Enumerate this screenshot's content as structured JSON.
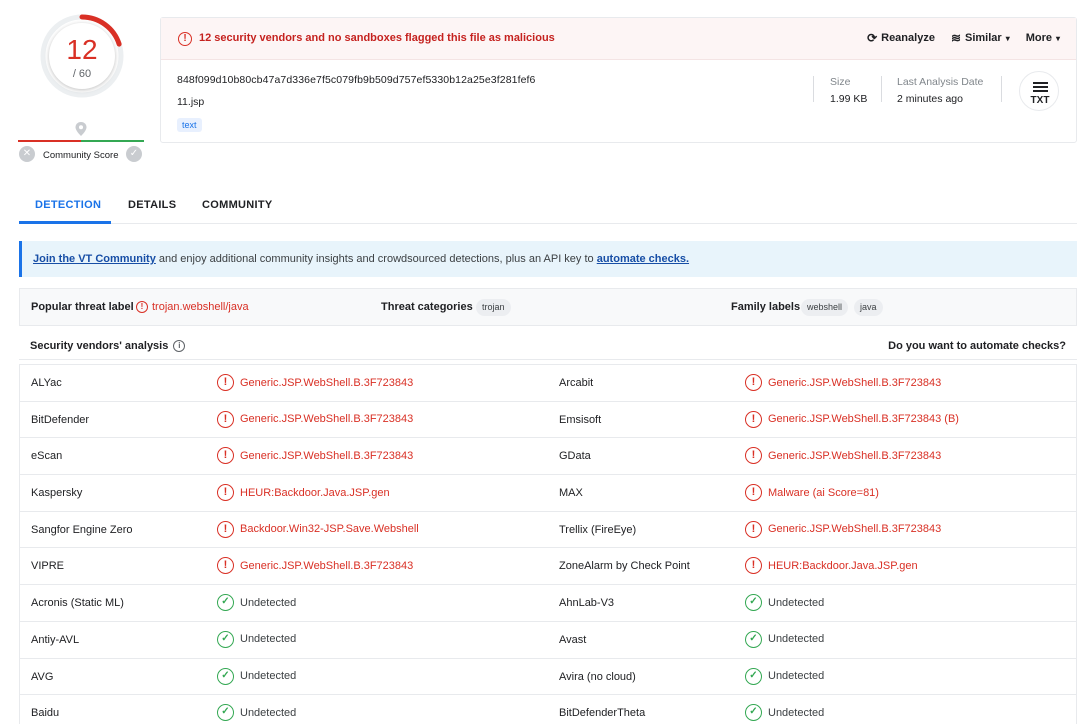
{
  "score": {
    "detections": "12",
    "total": "/ 60",
    "community_label": "Community Score",
    "fraction_flagged": 0.2
  },
  "alert": {
    "text": "12 security vendors and no sandboxes flagged this file as malicious"
  },
  "actions": {
    "reanalyze": "Reanalyze",
    "similar": "Similar",
    "more": "More"
  },
  "file": {
    "hash": "848f099d10b80cb47a7d336e7f5c079fb9b509d757ef5330b12a25e3f281fef6",
    "name": "11.jsp",
    "tag": "text",
    "size_label": "Size",
    "size_value": "1.99 KB",
    "date_label": "Last Analysis Date",
    "date_value": "2 minutes ago",
    "type_badge": "TXT"
  },
  "tabs": [
    {
      "label": "DETECTION"
    },
    {
      "label": "DETAILS"
    },
    {
      "label": "COMMUNITY"
    }
  ],
  "banner": {
    "link1": "Join the VT Community",
    "middle": " and enjoy additional community insights and crowdsourced detections, plus an API key to ",
    "link2": "automate checks."
  },
  "threat": {
    "popular_label": "Popular threat label",
    "popular_value": "trojan.webshell/java",
    "categories_label": "Threat categories",
    "categories": [
      "trojan"
    ],
    "family_label": "Family labels",
    "family": [
      "webshell",
      "java"
    ]
  },
  "analysis": {
    "title": "Security vendors' analysis",
    "automate": "Do you want to automate checks?"
  },
  "vendors": [
    {
      "left": {
        "name": "ALYac",
        "result": "Generic.JSP.WebShell.B.3F723843",
        "malicious": true
      },
      "right": {
        "name": "Arcabit",
        "result": "Generic.JSP.WebShell.B.3F723843",
        "malicious": true
      }
    },
    {
      "left": {
        "name": "BitDefender",
        "result": "Generic.JSP.WebShell.B.3F723843",
        "malicious": true
      },
      "right": {
        "name": "Emsisoft",
        "result": "Generic.JSP.WebShell.B.3F723843 (B)",
        "malicious": true
      }
    },
    {
      "left": {
        "name": "eScan",
        "result": "Generic.JSP.WebShell.B.3F723843",
        "malicious": true
      },
      "right": {
        "name": "GData",
        "result": "Generic.JSP.WebShell.B.3F723843",
        "malicious": true
      }
    },
    {
      "left": {
        "name": "Kaspersky",
        "result": "HEUR:Backdoor.Java.JSP.gen",
        "malicious": true
      },
      "right": {
        "name": "MAX",
        "result": "Malware (ai Score=81)",
        "malicious": true
      }
    },
    {
      "left": {
        "name": "Sangfor Engine Zero",
        "result": "Backdoor.Win32-JSP.Save.Webshell",
        "malicious": true
      },
      "right": {
        "name": "Trellix (FireEye)",
        "result": "Generic.JSP.WebShell.B.3F723843",
        "malicious": true
      }
    },
    {
      "left": {
        "name": "VIPRE",
        "result": "Generic.JSP.WebShell.B.3F723843",
        "malicious": true
      },
      "right": {
        "name": "ZoneAlarm by Check Point",
        "result": "HEUR:Backdoor.Java.JSP.gen",
        "malicious": true
      }
    },
    {
      "left": {
        "name": "Acronis (Static ML)",
        "result": "Undetected",
        "malicious": false
      },
      "right": {
        "name": "AhnLab-V3",
        "result": "Undetected",
        "malicious": false
      }
    },
    {
      "left": {
        "name": "Antiy-AVL",
        "result": "Undetected",
        "malicious": false
      },
      "right": {
        "name": "Avast",
        "result": "Undetected",
        "malicious": false
      }
    },
    {
      "left": {
        "name": "AVG",
        "result": "Undetected",
        "malicious": false
      },
      "right": {
        "name": "Avira (no cloud)",
        "result": "Undetected",
        "malicious": false
      }
    },
    {
      "left": {
        "name": "Baidu",
        "result": "Undetected",
        "malicious": false
      },
      "right": {
        "name": "BitDefenderTheta",
        "result": "Undetected",
        "malicious": false
      }
    }
  ],
  "colors": {
    "malicious": "#d93025",
    "clean": "#34a853",
    "accent": "#1a73e8"
  }
}
